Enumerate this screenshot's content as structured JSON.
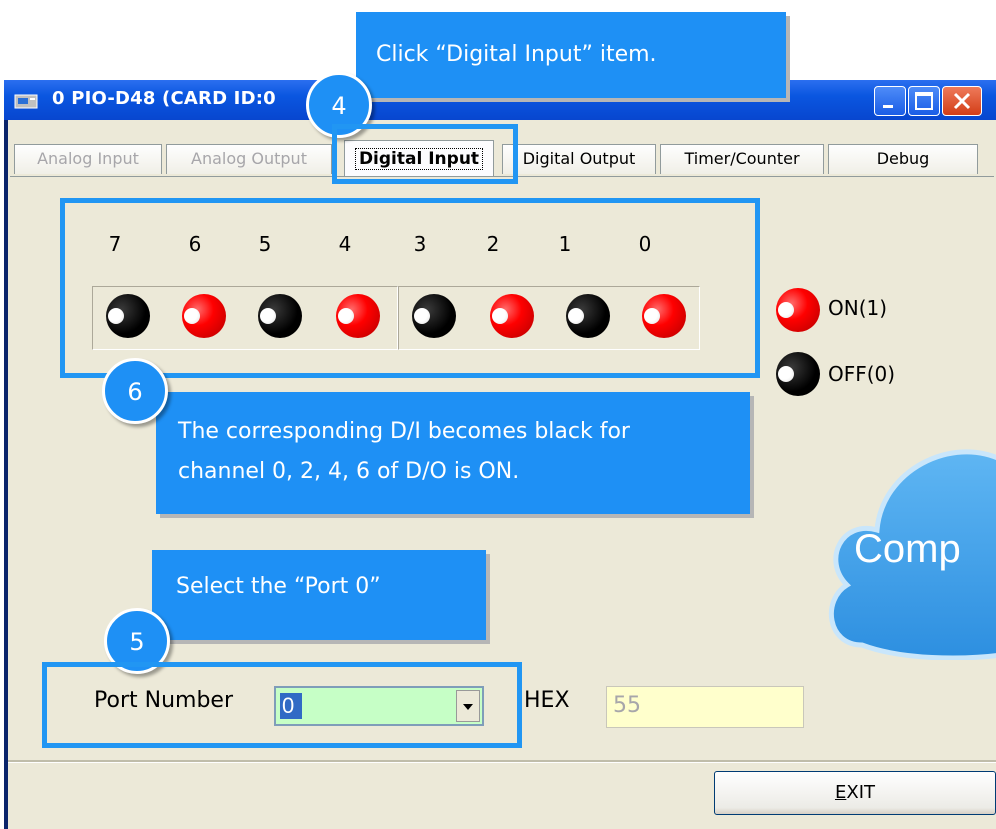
{
  "window": {
    "title": "0 PIO-D48 (CARD ID:0"
  },
  "tabs": [
    {
      "label": "Analog Input",
      "state": "disabled"
    },
    {
      "label": "Analog Output",
      "state": "disabled"
    },
    {
      "label": "Digital Input",
      "state": "active"
    },
    {
      "label": "Digital Output",
      "state": "normal"
    },
    {
      "label": "Timer/Counter",
      "state": "normal"
    },
    {
      "label": "Debug",
      "state": "normal"
    }
  ],
  "channels": {
    "numbers": [
      "7",
      "6",
      "5",
      "4",
      "3",
      "2",
      "1",
      "0"
    ],
    "states": [
      "off",
      "on",
      "off",
      "on",
      "off",
      "on",
      "off",
      "on"
    ]
  },
  "legend": {
    "on_label": "ON(1)",
    "off_label": "OFF(0)"
  },
  "port": {
    "label": "Port Number",
    "value": "0"
  },
  "hex": {
    "label": "HEX",
    "value": "55"
  },
  "exit_label": "EXIT",
  "annotations": {
    "callout_top": "Click “Digital Input” item.",
    "callout_middle_line1": "The corresponding D/I becomes black for",
    "callout_middle_line2": "channel 0, 2, 4, 6 of D/O is ON.",
    "callout_bottom": "Select the “Port 0”",
    "badge_4": "4",
    "badge_5": "5",
    "badge_6": "6",
    "cloud_text": "Comp"
  },
  "colors": {
    "accent": "#1e90f5",
    "led_on": "#ff0000",
    "led_off": "#000000",
    "panel": "#ece9d8"
  }
}
